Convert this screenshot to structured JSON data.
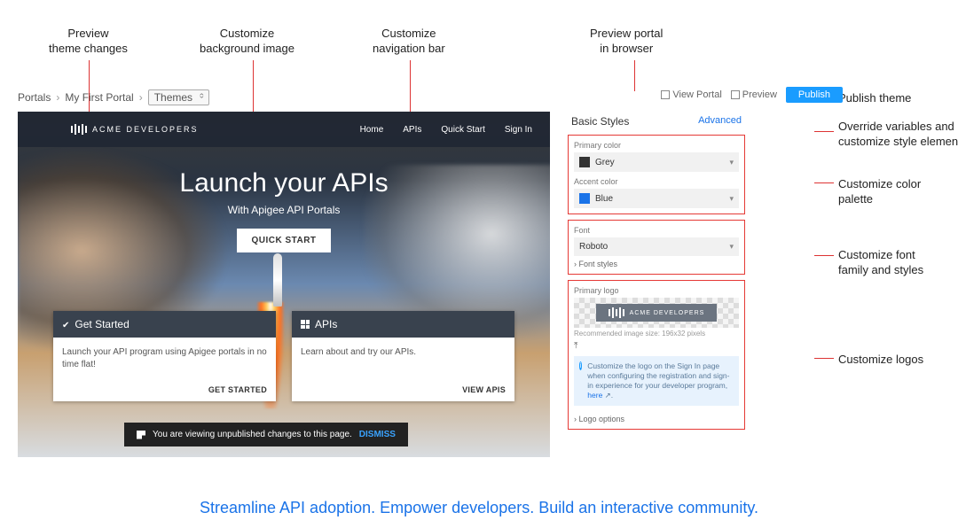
{
  "callouts": {
    "preview_theme": "Preview\ntheme changes",
    "customize_bg": "Customize\nbackground image",
    "customize_nav": "Customize\nnavigation bar",
    "preview_portal": "Preview portal\nin browser",
    "publish_theme": "Publish theme",
    "override": "Override variables and\ncustomize style elements",
    "color_palette": "Customize color palette",
    "font": "Customize font\nfamily and styles",
    "logos": "Customize logos"
  },
  "breadcrumb": {
    "root": "Portals",
    "portal": "My First Portal",
    "themes": "Themes"
  },
  "toolbar": {
    "view": "View Portal",
    "preview": "Preview",
    "publish": "Publish"
  },
  "nav": {
    "brand": "ACME DEVELOPERS",
    "links": [
      "Home",
      "APIs",
      "Quick Start",
      "Sign In"
    ]
  },
  "hero": {
    "title": "Launch your APIs",
    "subtitle": "With Apigee API Portals",
    "cta": "QUICK START"
  },
  "cards": [
    {
      "title": "Get Started",
      "body": "Launch your API program using Apigee portals in no time flat!",
      "action": "GET STARTED"
    },
    {
      "title": "APIs",
      "body": "Learn about and try our APIs.",
      "action": "VIEW APIS"
    }
  ],
  "banner": {
    "text": "You are viewing unpublished changes to this page.",
    "dismiss": "DISMISS"
  },
  "sidebar": {
    "title": "Basic Styles",
    "advanced": "Advanced",
    "primary": {
      "label": "Primary color",
      "value": "Grey",
      "swatch": "#333333"
    },
    "accent": {
      "label": "Accent color",
      "value": "Blue",
      "swatch": "#1a73e8"
    },
    "font": {
      "label": "Font",
      "value": "Roboto",
      "link": "Font styles"
    },
    "logo": {
      "label": "Primary logo",
      "brand": "ACME DEVELOPERS",
      "hint": "Recommended image size: 196x32 pixels",
      "info": "Customize the logo on the Sign In page when configuring the registration and sign-in experience for your developer program,",
      "here": "here",
      "options": "Logo options"
    }
  },
  "tagline": "Streamline API adoption. Empower developers. Build an interactive community."
}
